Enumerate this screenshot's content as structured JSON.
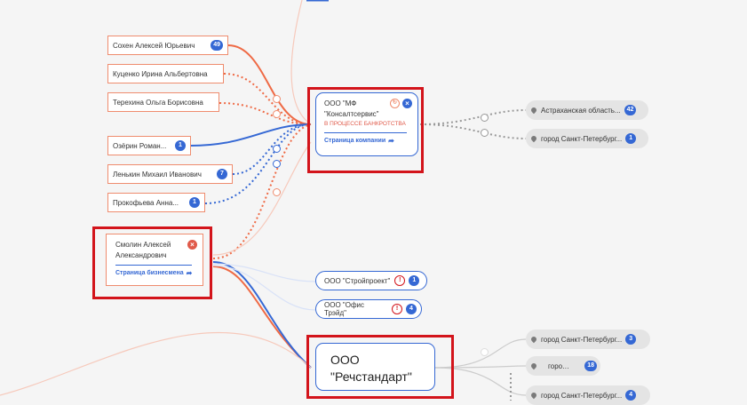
{
  "persons": [
    {
      "name": "Сохен Алексей Юрьевич",
      "badge": "49"
    },
    {
      "name": "Куценко Ирина Альбертовна",
      "badge": ""
    },
    {
      "name": "Терехина Ольга Борисовна",
      "badge": ""
    },
    {
      "name": "Озёрин Роман...",
      "badge": "1"
    },
    {
      "name": "Ленькин Михаил Иванович",
      "badge": "7"
    },
    {
      "name": "Прокофьева Анна...",
      "badge": "1"
    }
  ],
  "selected_person": {
    "name": "Смолин Алексей Александрович",
    "link": "Страница бизнесмена"
  },
  "company_mf": {
    "name_line1": "ООО \"МФ",
    "name_line2": "\"Консалтсервис\"",
    "status": "В ПРОЦЕССЕ БАНКРОТСТВА",
    "link": "Страница компании"
  },
  "companies_small": [
    {
      "name": "ООО \"Стройпроект\"",
      "badge": "1"
    },
    {
      "name": "ООО \"Офис Трэйд\"",
      "badge": "4"
    }
  ],
  "company_rech": {
    "line1": "ООО",
    "line2": "\"Речстандарт\""
  },
  "locations": [
    {
      "name": "Астраханская область...",
      "badge": "42"
    },
    {
      "name": "город Санкт-Петербург...",
      "badge": "1"
    },
    {
      "name": "город Санкт-Петербург...",
      "badge": "3"
    },
    {
      "name": "город...",
      "badge": "18"
    },
    {
      "name": "город Санкт-Петербург...",
      "badge": "4"
    }
  ],
  "colors": {
    "accent_blue": "#3568d4",
    "relation_orange": "#ef6a45",
    "highlight_red": "#d3141b",
    "location_gray": "#e4e4e4"
  }
}
